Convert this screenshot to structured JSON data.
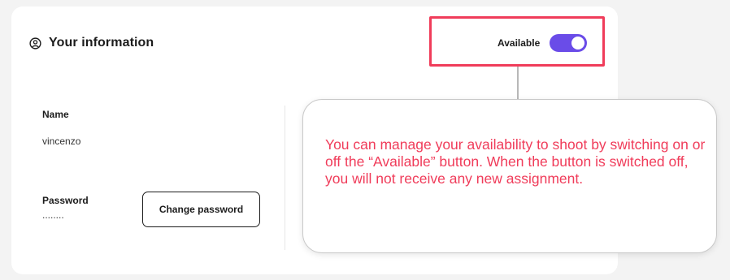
{
  "card": {
    "title": "Your information",
    "user_icon": "user-circle-icon"
  },
  "availability": {
    "label": "Available",
    "enabled": true,
    "toggle_color": "#6a4ce8",
    "highlight_color": "#f03c5a"
  },
  "fields": {
    "name": {
      "label": "Name",
      "value": "vincenzo"
    },
    "password": {
      "label": "Password",
      "value": "........"
    }
  },
  "buttons": {
    "change_password": "Change password"
  },
  "tooltip": {
    "text": "You can manage your availability to shoot by switching on or off the “Available” button. When the button is switched off, you will not receive any new assignment.",
    "text_color": "#f03c5a"
  }
}
